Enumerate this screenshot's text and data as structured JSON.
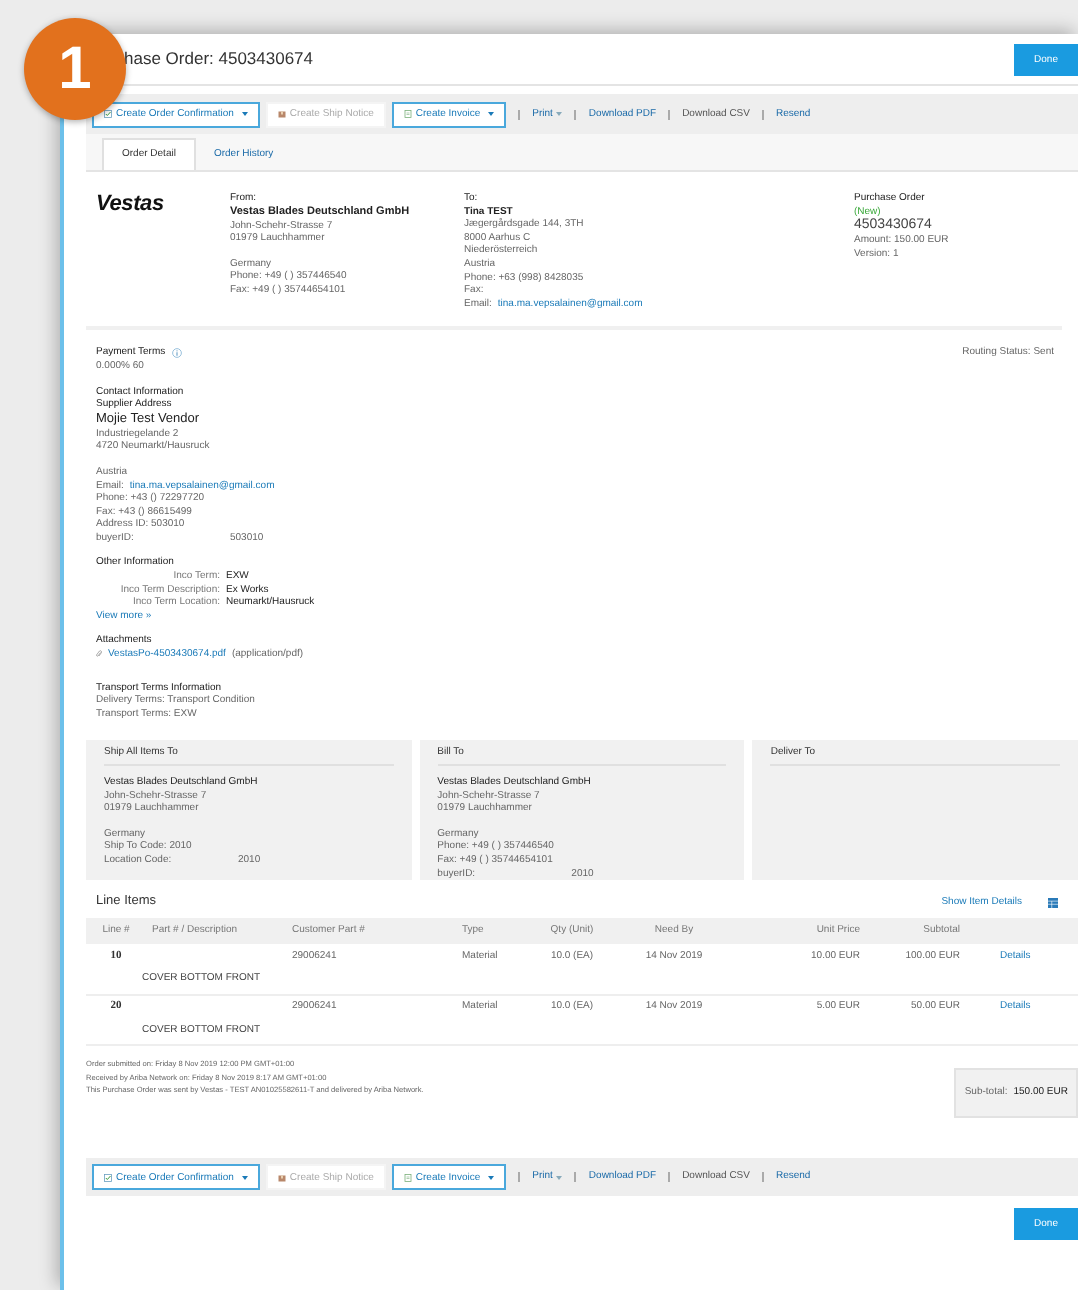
{
  "badge": "1",
  "title": "hase Order: 4503430674",
  "done_top": "Done",
  "toolbars": [
    {
      "buttons": [
        {
          "label": "Create Order Confirmation",
          "kind": "confirm",
          "dropdown": true,
          "disabled": false
        },
        {
          "label": "Create Ship Notice",
          "kind": "ship",
          "dropdown": false,
          "disabled": true
        },
        {
          "label": "Create Invoice",
          "kind": "invoice",
          "dropdown": true,
          "disabled": false
        }
      ],
      "links": [
        {
          "label": "Print",
          "dropdown": true,
          "disabled": false
        },
        {
          "label": "Download PDF",
          "dropdown": false,
          "disabled": false
        },
        {
          "label": "Download CSV",
          "dropdown": false,
          "disabled": true
        },
        {
          "label": "Resend",
          "dropdown": false,
          "disabled": false
        }
      ]
    },
    {
      "buttons": [
        {
          "label": "Create Order Confirmation",
          "kind": "confirm",
          "dropdown": true,
          "disabled": false
        },
        {
          "label": "Create Ship Notice",
          "kind": "ship",
          "dropdown": false,
          "disabled": true
        },
        {
          "label": "Create Invoice",
          "kind": "invoice",
          "dropdown": true,
          "disabled": false
        }
      ],
      "links": [
        {
          "label": "Print",
          "dropdown": true,
          "disabled": false
        },
        {
          "label": "Download PDF",
          "dropdown": false,
          "disabled": false
        },
        {
          "label": "Download CSV",
          "dropdown": false,
          "disabled": true
        },
        {
          "label": "Resend",
          "dropdown": false,
          "disabled": false
        }
      ]
    }
  ],
  "tabs": [
    {
      "label": "Order Detail",
      "selected": true
    },
    {
      "label": "Order History",
      "selected": false
    }
  ],
  "logo": "Vestas",
  "from": {
    "label": "From:",
    "name": "Vestas Blades Deutschland GmbH",
    "address": [
      "John-Schehr-Strasse 7",
      "01979 Lauchhammer"
    ],
    "details": [
      "Germany",
      "Phone:  +49 ( ) 357446540",
      "Fax:  +49 ( ) 35744654101"
    ]
  },
  "to": {
    "label": "To:",
    "name": "Tina TEST",
    "lines": [
      "Jægergårdsgade 144, 3TH",
      "8000 Aarhus C",
      "Niederösterreich",
      "Austria",
      "Phone: +63 (998) 8428035",
      "Fax:"
    ],
    "email_label": "Email:",
    "email": "tina.ma.vepsalainen@gmail.com"
  },
  "po": {
    "label": "Purchase Order",
    "status": "(New)",
    "number": "4503430674",
    "lines": [
      "Amount: 150.00 EUR",
      "Version: 1"
    ]
  },
  "payment": {
    "label": "Payment Terms",
    "value": "0.000% 60"
  },
  "routing": "Routing Status: Sent",
  "contact": {
    "heading": "Contact Information",
    "subheading": "Supplier Address",
    "name": "Mojie Test Vendor",
    "address": [
      "Industriegelande 2",
      "4720 Neumarkt/Hausruck"
    ],
    "country": "Austria",
    "email_label": "Email:",
    "email": "tina.ma.vepsalainen@gmail.com",
    "lines": [
      "Phone:  +43 () 72297720",
      "Fax:  +43 () 86615499",
      "Address ID:  503010"
    ],
    "pair": {
      "label": "buyerID:",
      "value": "503010"
    }
  },
  "other": {
    "heading": "Other Information",
    "rows": [
      {
        "label": "Inco Term:",
        "value": "EXW"
      },
      {
        "label": "Inco Term Description:",
        "value": "Ex Works"
      },
      {
        "label": "Inco Term Location:",
        "value": "Neumarkt/Hausruck"
      }
    ],
    "link": "View more »"
  },
  "attachments": {
    "heading": "Attachments",
    "file": "VestasPo-4503430674.pdf",
    "type": "(application/pdf)"
  },
  "transport": {
    "heading": "Transport Terms Information",
    "lines": [
      "Delivery Terms: Transport Condition",
      "Transport Terms: EXW"
    ]
  },
  "addresses": [
    {
      "title": "Ship All Items To",
      "name": "Vestas Blades Deutschland GmbH",
      "address": [
        "John-Schehr-Strasse 7",
        "01979 Lauchhammer"
      ],
      "details": [
        "Germany",
        "Ship To Code:  2010"
      ],
      "pair": {
        "label": "Location Code:",
        "value": "2010"
      }
    },
    {
      "title": "Bill To",
      "name": "Vestas Blades Deutschland GmbH",
      "address": [
        "John-Schehr-Strasse 7",
        "01979 Lauchhammer"
      ],
      "details": [
        "Germany",
        "Phone:  +49 ( ) 357446540",
        "Fax:  +49 ( ) 35744654101"
      ],
      "pair": {
        "label": "buyerID:",
        "value": "2010"
      }
    },
    {
      "title": "Deliver To"
    }
  ],
  "line_items": {
    "title": "Line Items",
    "show_details": "Show Item Details",
    "columns": [
      "Line #",
      "Part # / Description",
      "Customer Part #",
      "Type",
      "Qty (Unit)",
      "Need By",
      "Unit Price",
      "Subtotal"
    ],
    "rows": [
      {
        "line": "10",
        "customer_part": "29006241",
        "type": "Material",
        "qty": "10.0 (EA)",
        "need_by": "14 Nov 2019",
        "unit_price": "10.00 EUR",
        "subtotal": "100.00 EUR",
        "action": "Details",
        "description": "COVER BOTTOM FRONT"
      },
      {
        "line": "20",
        "customer_part": "29006241",
        "type": "Material",
        "qty": "10.0 (EA)",
        "need_by": "14 Nov 2019",
        "unit_price": "5.00 EUR",
        "subtotal": "50.00 EUR",
        "action": "Details",
        "description": "COVER BOTTOM FRONT"
      }
    ]
  },
  "notes": [
    "Order submitted on: Friday 8 Nov 2019 12:00 PM GMT+01:00",
    "Received by Ariba Network on: Friday 8 Nov 2019 8:17 AM GMT+01:00",
    "This Purchase Order was sent by Vestas - TEST AN01025582611-T and delivered by Ariba Network."
  ],
  "subtotal": {
    "label": "Sub-total:",
    "value": "150.00 EUR"
  },
  "done_bottom": "Done"
}
